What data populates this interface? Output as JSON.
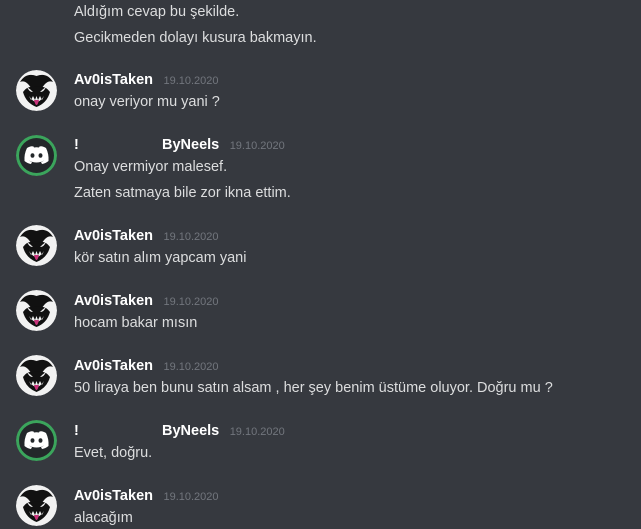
{
  "messages": [
    {
      "author": "",
      "timestamp": "",
      "lines": [
        "Aldığım cevap bu şekilde.",
        "Gecikmeden dolayı kusura bakmayın."
      ]
    },
    {
      "author": "Av0isTaken",
      "timestamp": "19.10.2020",
      "avatar": "venom-avatar",
      "lines": [
        "onay veriyor mu yani ?"
      ]
    },
    {
      "author_prefix": "!",
      "author": "ByNeels",
      "timestamp": "19.10.2020",
      "avatar": "discord-logo-avatar",
      "lines": [
        "Onay vermiyor malesef.",
        "Zaten satmaya bile zor ikna ettim."
      ]
    },
    {
      "author": "Av0isTaken",
      "timestamp": "19.10.2020",
      "avatar": "venom-avatar",
      "lines": [
        "kör satın alım yapcam yani"
      ]
    },
    {
      "author": "Av0isTaken",
      "timestamp": "19.10.2020",
      "avatar": "venom-avatar",
      "lines": [
        "hocam bakar mısın"
      ]
    },
    {
      "author": "Av0isTaken",
      "timestamp": "19.10.2020",
      "avatar": "venom-avatar",
      "lines": [
        "50 liraya ben bunu satın alsam , her şey benim üstüme oluyor. Doğru mu ?"
      ]
    },
    {
      "author_prefix": "!",
      "author": "ByNeels",
      "timestamp": "19.10.2020",
      "avatar": "discord-logo-avatar",
      "lines": [
        "Evet, doğru."
      ]
    },
    {
      "author": "Av0isTaken",
      "timestamp": "19.10.2020",
      "avatar": "venom-avatar",
      "lines": [
        "alacağım"
      ]
    }
  ],
  "colors": {
    "background": "#36393f",
    "message_text": "#dcddde",
    "username": "#ffffff",
    "timestamp": "#72767d",
    "discord_green_ring": "#3ba55c"
  }
}
